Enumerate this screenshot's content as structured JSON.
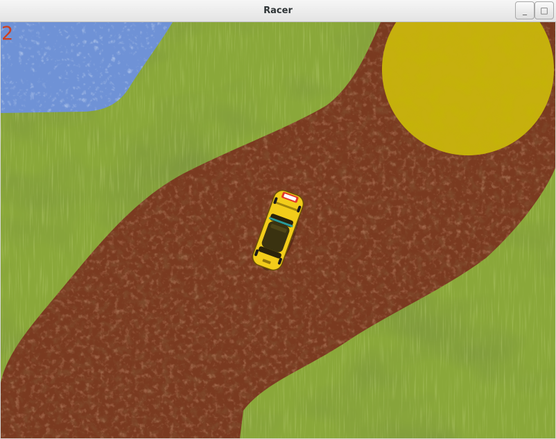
{
  "window": {
    "title": "Racer",
    "minimize_symbol": "_",
    "maximize_symbol": "□"
  },
  "hud": {
    "counter": "2"
  },
  "scene": {
    "icons": {
      "water": "water-texture",
      "grass": "grass-texture",
      "dirt": "dirt-track-texture",
      "sand": "yellow-sand-circle",
      "player": "yellow-taxi-car"
    },
    "colors": {
      "grass": "#8aa83a",
      "grass_dark": "#4a6a1a",
      "dirt": "#7a3a20",
      "dirt_dark": "#4a1e10",
      "water": "#6f92d6",
      "sand": "#c6b00e",
      "car": "#f2cc1a",
      "car_roof": "#3a3210",
      "counter": "#d0401e"
    }
  }
}
